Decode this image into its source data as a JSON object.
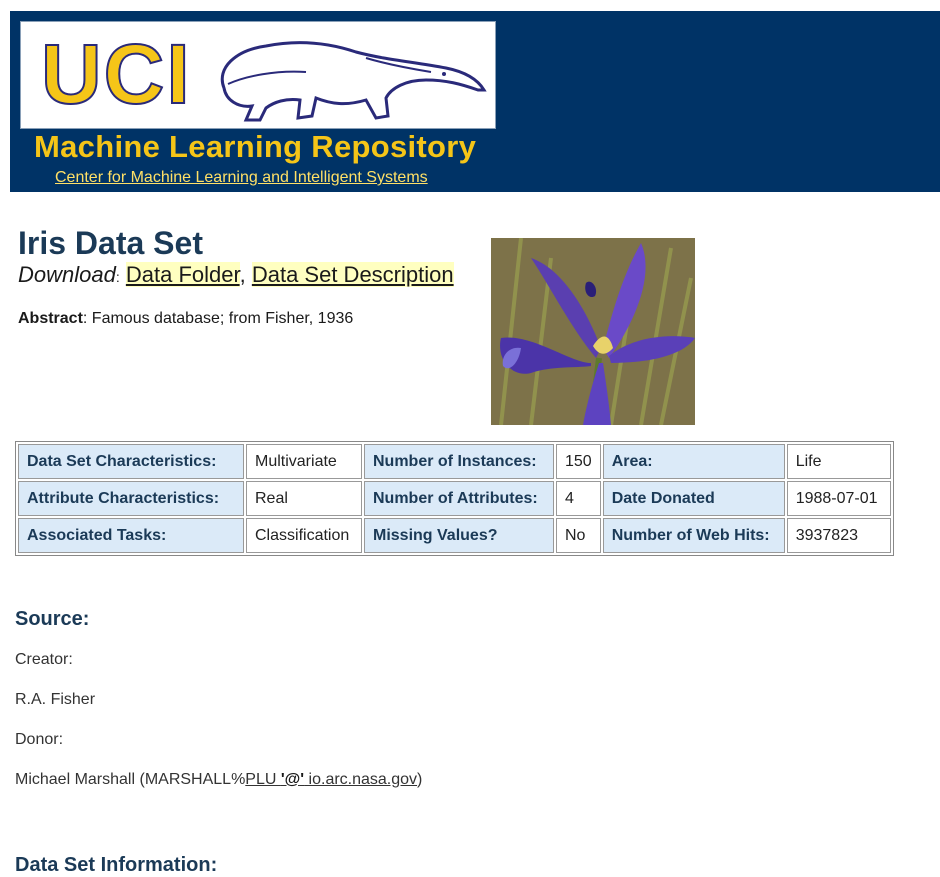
{
  "header": {
    "logo_text": "UCI",
    "title": "Machine Learning Repository",
    "subtitle_link": "Center for Machine Learning and Intelligent Systems"
  },
  "dataset": {
    "title": "Iris Data Set",
    "download_label": "Download",
    "download_sep": ":",
    "link_folder": "Data Folder",
    "link_comma": ",",
    "link_description": "Data Set Description",
    "abstract_label": "Abstract",
    "abstract_text": ": Famous database; from Fisher, 1936",
    "image_subject": "iris-flower-photo"
  },
  "meta_table": {
    "rows": [
      [
        "Data Set Characteristics:",
        "Multivariate",
        "Number of Instances:",
        "150",
        "Area:",
        "Life"
      ],
      [
        "Attribute Characteristics:",
        "Real",
        "Number of Attributes:",
        "4",
        "Date Donated",
        "1988-07-01"
      ],
      [
        "Associated Tasks:",
        "Classification",
        "Missing Values?",
        "No",
        "Number of Web Hits:",
        "3937823"
      ]
    ]
  },
  "source": {
    "heading": "Source:",
    "creator_label": "Creator:",
    "creator_name": "R.A. Fisher",
    "donor_label": "Donor:",
    "donor_prefix": "Michael Marshall (MARSHALL%",
    "donor_link_a": "PLU ",
    "donor_link_at": "'@'",
    "donor_link_b": " io.arc.nasa.gov",
    "donor_suffix": ")"
  },
  "info": {
    "heading": "Data Set Information:"
  },
  "colors": {
    "banner": "#003366",
    "logo_yellow": "#f5c518",
    "key_cell": "#dbeaf8",
    "link_highlight": "#ffffc0"
  }
}
